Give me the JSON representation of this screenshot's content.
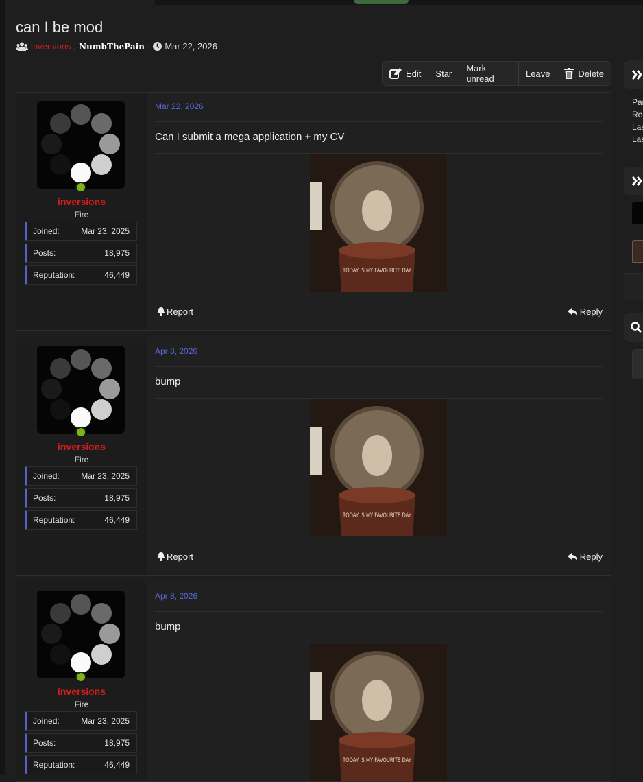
{
  "thread": {
    "title": "can I be mod",
    "participant_1": "inversions",
    "participant_2": "NumbThePain",
    "date": "Mar 22, 2026"
  },
  "toolbar": {
    "edit": "Edit",
    "star": "Star",
    "mark_unread": "Mark unread",
    "leave": "Leave",
    "delete": "Delete"
  },
  "labels": {
    "joined": "Joined:",
    "posts": "Posts:",
    "reputation": "Reputation:",
    "report": "Report",
    "reply": "Reply"
  },
  "posts": [
    {
      "username": "inversions",
      "user_title": "Fire",
      "joined": "Mar 23, 2025",
      "posts": "18,975",
      "reputation": "46,449",
      "date": "Mar 22, 2026",
      "text": "Can I submit a mega application + my CV",
      "image_text": "TODAY IS MY FAVOURITE DAY"
    },
    {
      "username": "inversions",
      "user_title": "Fire",
      "joined": "Mar 23, 2025",
      "posts": "18,975",
      "reputation": "46,449",
      "date": "Apr 8, 2026",
      "text": "bump",
      "image_text": "TODAY IS MY FAVOURITE DAY"
    },
    {
      "username": "inversions",
      "user_title": "Fire",
      "joined": "Mar 23, 2025",
      "posts": "18,975",
      "reputation": "46,449",
      "date": "Apr 8, 2026",
      "text": "bump",
      "image_text": "TODAY IS MY FAVOURITE DAY"
    }
  ],
  "sidebar": {
    "info_lines": [
      "Par",
      "Rep",
      "Las",
      "Las"
    ]
  },
  "colors": {
    "accent": "#5561c6",
    "username": "#d11c1c",
    "online": "#7bb612",
    "date": "#5968d6"
  }
}
